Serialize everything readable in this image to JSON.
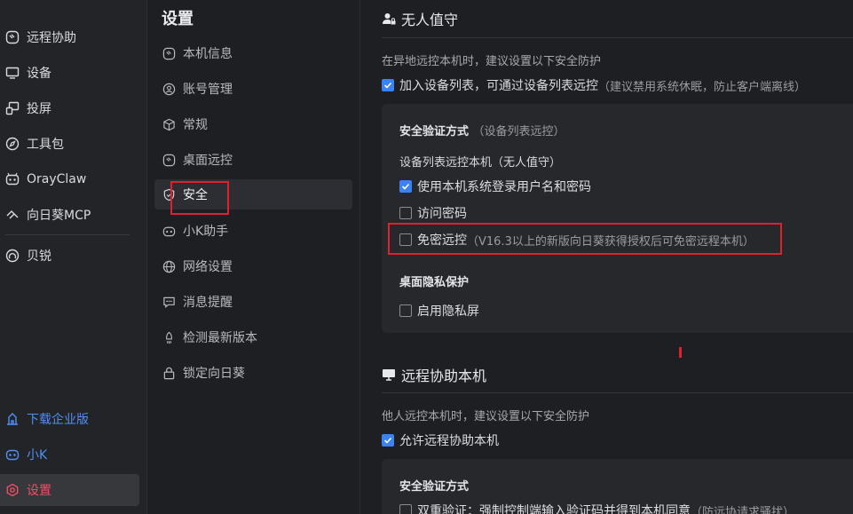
{
  "app_nav": {
    "items": [
      {
        "label": "远程协助",
        "icon": "remote-assist-icon"
      },
      {
        "label": "设备",
        "icon": "monitor-icon"
      },
      {
        "label": "投屏",
        "icon": "cast-icon"
      },
      {
        "label": "工具包",
        "icon": "compass-icon"
      },
      {
        "label": "OrayClaw",
        "icon": "claw-icon"
      },
      {
        "label": "向日葵MCP",
        "icon": "mcp-icon"
      },
      {
        "label": "贝锐",
        "icon": "oray-icon"
      }
    ],
    "bottom": [
      {
        "label": "下载企业版",
        "icon": "enterprise-icon"
      },
      {
        "label": "小K",
        "icon": "bot-icon"
      },
      {
        "label": "设置",
        "icon": "settings-hex-icon"
      }
    ]
  },
  "settings_nav": {
    "title": "设置",
    "items": [
      {
        "label": "本机信息",
        "icon": "info-icon"
      },
      {
        "label": "账号管理",
        "icon": "account-icon"
      },
      {
        "label": "常规",
        "icon": "cube-icon"
      },
      {
        "label": "桌面远控",
        "icon": "desktop-remote-icon"
      },
      {
        "label": "安全",
        "icon": "shield-icon"
      },
      {
        "label": "小K助手",
        "icon": "bot-icon"
      },
      {
        "label": "网络设置",
        "icon": "globe-icon"
      },
      {
        "label": "消息提醒",
        "icon": "message-icon"
      },
      {
        "label": "检测最新版本",
        "icon": "rocket-icon"
      },
      {
        "label": "锁定向日葵",
        "icon": "lock-icon"
      }
    ]
  },
  "unattended": {
    "title": "无人值守",
    "desc": "在异地远控本机时，建议设置以下安全防护",
    "add_to_list": {
      "label": "加入设备列表，可通过设备列表远控",
      "note": "（建议禁用系统休眠，防止客户端离线）",
      "checked": true
    },
    "card": {
      "auth_title": "安全验证方式",
      "auth_sub": "（设备列表远控）",
      "list_label": "设备列表远控本机（无人值守）",
      "opt_system_login": {
        "label": "使用本机系统登录用户名和密码",
        "checked": true
      },
      "opt_access_password": {
        "label": "访问密码",
        "checked": false
      },
      "opt_passwordless": {
        "label": "免密远控",
        "note": "（V16.3以上的新版向日葵获得授权后可免密远程本机）",
        "checked": false
      },
      "privacy_title": "桌面隐私保护",
      "opt_privacy_screen": {
        "label": "启用隐私屏",
        "checked": false
      }
    }
  },
  "remote_assist": {
    "title": "远程协助本机",
    "desc": "他人远控本机时，建议设置以下安全防护",
    "allow": {
      "label": "允许远程协助本机",
      "checked": true
    },
    "card": {
      "auth_title": "安全验证方式",
      "opt_two_factor": {
        "label": "双重验证：强制控制端输入验证码并得到本机同意",
        "note": "（防远协请求骚扰）",
        "checked": false
      }
    }
  },
  "colors": {
    "accent": "#3b82f6",
    "active_red": "#ef4f63",
    "highlight": "#e0202c",
    "link_blue": "#4f8ff7"
  }
}
